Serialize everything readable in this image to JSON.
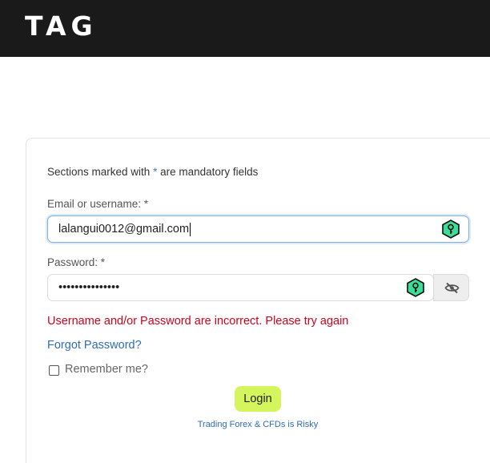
{
  "header": {
    "logo_text": "TAG"
  },
  "form": {
    "mandatory_note_prefix": "Sections marked with ",
    "mandatory_note_star": "*",
    "mandatory_note_suffix": " are mandatory fields",
    "email_label": "Email or username: *",
    "email_value": "lalangui0012@gmail.com",
    "password_label": "Password: *",
    "password_value": "•••••••••••••••",
    "error_message": "Username and/or Password are incorrect. Please try again",
    "forgot_password": "Forgot Password?",
    "remember_me": "Remember me?",
    "remember_checked": false,
    "login_button": "Login",
    "risk_link": "Trading Forex & CFDs is Risky"
  },
  "icons": {
    "password_manager": "key-hexagon-icon",
    "toggle_visibility": "eye-slash-icon"
  },
  "colors": {
    "header_bg": "#1a1a1a",
    "login_button_bg": "#d4f55b",
    "error": "#d0021b",
    "link": "#2f6db5",
    "key_icon_fill": "#3ddc97"
  }
}
